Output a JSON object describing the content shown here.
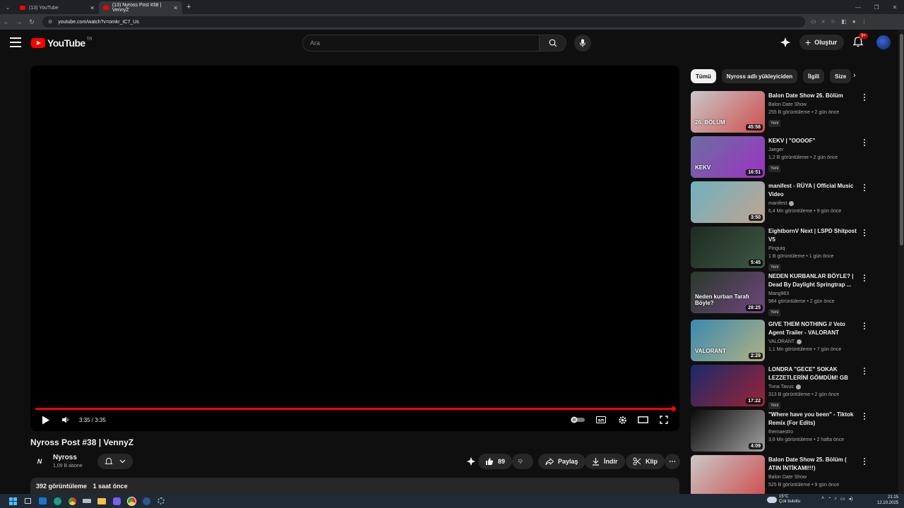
{
  "browser": {
    "tabs": [
      {
        "label": "(13) YouTube",
        "active": false
      },
      {
        "label": "(13) Nyross Post #38 | VennyZ",
        "active": true
      }
    ],
    "url": "youtube.com/watch?v=omkr_tC7_Us"
  },
  "header": {
    "logo_text": "YouTube",
    "logo_country": "TR",
    "search_placeholder": "Ara",
    "create_label": "Oluştur",
    "notification_count": "9+"
  },
  "player": {
    "time": "3:35 / 3:35",
    "progress": 1.0
  },
  "video": {
    "title": "Nyross Post #38 | VennyZ",
    "channel_initial": "N",
    "channel_name": "Nyross",
    "subscribers": "1,09 B abone",
    "likes": "89",
    "share_label": "Paylaş",
    "download_label": "İndir",
    "clip_label": "Klip",
    "views": "392 görüntüleme",
    "posted": "1 saat önce"
  },
  "chips": [
    {
      "label": "Tümü",
      "active": true
    },
    {
      "label": "Nyross adlı yükleyiciden",
      "active": false
    },
    {
      "label": "İlgili",
      "active": false
    },
    {
      "label": "Size",
      "active": false
    }
  ],
  "recommendations": [
    {
      "title": "Balon Date Show 26. Bölüm",
      "channel": "Balon Date Show",
      "verified": false,
      "meta": "255 B görüntüleme • 2 gün önce",
      "badge": "Yeni",
      "duration": "45:58",
      "thumb_color": "#c8c8c8",
      "thumb_accent": "#d21e1e",
      "thumb_text": "26. BÖLÜM"
    },
    {
      "title": "KEKV | \"OOOOF\"",
      "channel": "Jaeger",
      "verified": false,
      "meta": "1,2 B görüntüleme • 2 gün önce",
      "badge": "Yeni",
      "duration": "16:51",
      "thumb_color": "#6b6ea0",
      "thumb_accent": "#b01bd0",
      "thumb_text": "KEKV"
    },
    {
      "title": "manifest - RÜYA | Official Music Video",
      "channel": "manifest",
      "verified": true,
      "meta": "6,4 Mn görüntüleme • 9 gün önce",
      "badge": "",
      "duration": "3:50",
      "thumb_color": "#6fb0c0",
      "thumb_accent": "#e0a080",
      "thumb_text": ""
    },
    {
      "title": "EightbornV Next | LSPD Shitpost V5",
      "channel": "Pinguiq",
      "verified": false,
      "meta": "1 B görüntüleme • 1 gün önce",
      "badge": "Yeni",
      "duration": "5:45",
      "thumb_color": "#1e2a22",
      "thumb_accent": "#4a6a50",
      "thumb_text": ""
    },
    {
      "title": "NEDEN KURBANLAR BÖYLE? | Dead By Daylight Springtrap ...",
      "channel": "Mang963",
      "verified": false,
      "meta": "984 görüntüleme • 2 gün önce",
      "badge": "Yeni",
      "duration": "28:25",
      "thumb_color": "#2a3a2a",
      "thumb_accent": "#8a4aa0",
      "thumb_text": "Neden kurban Tarafı Böyle?"
    },
    {
      "title": "GIVE THEM NOTHING // Veto Agent Trailer - VALORANT",
      "channel": "VALORANT",
      "verified": true,
      "meta": "1,1 Mn görüntüleme • 7 gün önce",
      "badge": "",
      "duration": "2:29",
      "thumb_color": "#3a8ab0",
      "thumb_accent": "#e0c070",
      "thumb_text": "VALORANT"
    },
    {
      "title": "LONDRA \"GECE\" SOKAK LEZZETLERİNİ GÖMDÜM! GB",
      "channel": "Tuna Tavus",
      "verified": true,
      "meta": "313 B görüntüleme • 2 gün önce",
      "badge": "Yeni",
      "duration": "17:22",
      "thumb_color": "#1a2a6a",
      "thumb_accent": "#d02020",
      "thumb_text": ""
    },
    {
      "title": "\"Where have you been\" - Tiktok Remix (For Edits)",
      "channel": "themaestro",
      "verified": false,
      "meta": "3,6 Mn görüntüleme • 2 hafta önce",
      "badge": "",
      "duration": "4:09",
      "thumb_color": "#0a0a0a",
      "thumb_accent": "#dddddd",
      "thumb_text": ""
    },
    {
      "title": "Balon Date Show 25. Bölüm ( ATIN İNTİKAMI!!!)",
      "channel": "Balon Date Show",
      "verified": false,
      "meta": "525 B görüntüleme • 9 gün önce",
      "badge": "",
      "duration": "",
      "thumb_color": "#c8c8c8",
      "thumb_accent": "#d21e1e",
      "thumb_text": ""
    }
  ],
  "taskbar": {
    "weather_temp": "15°C",
    "weather_desc": "Çok bulutlu",
    "time": "21:15",
    "date": "12.10.2025"
  }
}
